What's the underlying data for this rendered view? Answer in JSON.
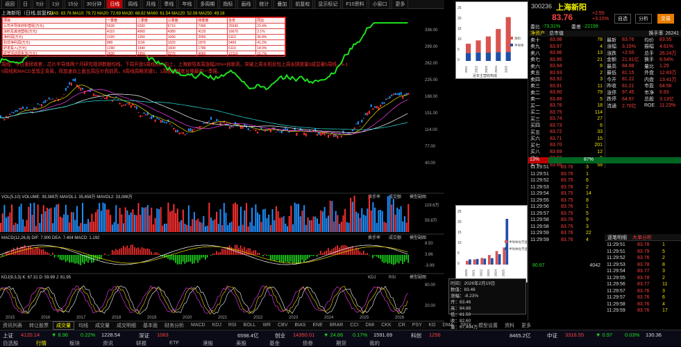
{
  "toolbar": {
    "items": [
      "返回",
      "日",
      "5分",
      "1分",
      "15分",
      "30分钟",
      "日线",
      "周线",
      "月线",
      "季线",
      "年线",
      "多周期",
      "指标",
      "画线",
      "统计",
      "叠加",
      "前复权",
      "显示标记",
      "F10资料",
      "小窗口",
      "更多"
    ],
    "active_index": 6
  },
  "chart": {
    "title": "上海新阳（日线,前复权）",
    "ma_line": "MA5: 83.76  MA10: 79.72  MA20: 72.69  MA30: 68.62  MA60: 61.54  MA120: 52.08  MA250: 49.18",
    "right_tabs": [
      "公告",
      "叠加",
      "指标",
      "回顾"
    ],
    "comment": "周线：今日重磅收官，芯片半导体两个月研究观测数据均线，下周开盘5周线拐头向上，上海新阳本周涨幅20%+创新高，突破上周长阳反包上周长阴放量3成显著5周线，5-10周线和MACD呈现正背离，拜加速向上面五周压价而前高，9周线周期关键1，1周面超越底长期最的一季报。",
    "price_labels": [
      "336.00",
      "299.00",
      "262.00",
      "225.00",
      "188.00",
      "151.00",
      "114.00",
      "77.00",
      "40.00"
    ],
    "vol_title": "VOL(5,10)  VOLUME: 39,369万  MAVOL1: 35,658万  MAVOL2: 33,086万",
    "vol_tabs": [
      "换手率",
      "成交额",
      "模型副图"
    ],
    "vol_labels": [
      "119.6万",
      "59.8万"
    ],
    "macd_title": "MACD(12,26,9)  DIF: 7.900  DEA: 7.404  MACD: 1.192",
    "macd_tabs": [
      "换手率",
      "成交额",
      "模型副图"
    ],
    "macd_labels": [
      "8.50",
      "3.86",
      "-3.99"
    ],
    "kdj_title": "KDJ(9,3,3)  K: 67.31  D: 59.99  J: 81.95",
    "kdj_tabs": [
      "KDJ",
      "RSI",
      "模型副图"
    ],
    "kdj_labels": [
      "80.00",
      "20.00"
    ],
    "years": [
      "2015",
      "2016",
      "2017",
      "2018",
      "2019",
      "2020",
      "2021",
      "2022",
      "2023",
      "2024",
      "2025",
      "2026"
    ],
    "volume_profile_label": "成本分布"
  },
  "datatable": {
    "headers": [
      "项目",
      "一季度",
      "二季度",
      "三季度",
      "四季度",
      "全年",
      "同比"
    ],
    "rows": [
      [
        "公司半导体材料营收(万元)",
        "5630",
        "6200",
        "6710",
        "7390",
        "25930",
        "23.4%"
      ],
      [
        "涂料及其他营收(万元)",
        "4110",
        "4060",
        "4380",
        "4120",
        "16670",
        "2.1%"
      ],
      [
        "净利润(万元)",
        "1020",
        "1350",
        "1690",
        "2050",
        "6110",
        "36.8%"
      ],
      [
        "扣非净利润(万元)",
        "880",
        "1190",
        "1520",
        "1870",
        "5460",
        "41.2%"
      ],
      [
        "研发投入(万元)",
        "1290",
        "1440",
        "1600",
        "1780",
        "6110",
        "18.9%"
      ],
      [
        "经营活动现金流(万元)",
        "2830",
        "1950",
        "3270",
        "4060",
        "12110",
        "15.7%"
      ]
    ]
  },
  "popup1": {
    "legend": [
      "涂料",
      "半导体"
    ],
    "caption": "近年主营收构成",
    "years": [
      "2021",
      "2022",
      "2023",
      "2024",
      "2025"
    ],
    "coat": [
      3.8,
      4.1,
      4.0,
      4.2,
      4.3
    ],
    "semi": [
      4.5,
      5.8,
      7.8,
      11.2,
      16.8
    ],
    "ylim": [
      0,
      25
    ],
    "ticks": [
      "25",
      "20",
      "15",
      "10",
      "5",
      "0"
    ]
  },
  "popup2": {
    "legend": [
      "半导体化学品营收（亿元）",
      "半导体化学品产能（万吨）"
    ],
    "years": [
      "2020",
      "2021",
      "2022",
      "2023",
      "2024",
      "2025"
    ],
    "rev": [
      1.8,
      2.5,
      3.2,
      4.6,
      6.5,
      8.2
    ],
    "cap": [
      2.5,
      2.7,
      2.9,
      3.1,
      5.0,
      22.0
    ],
    "ylim": [
      0,
      25
    ],
    "ticks": [
      "25",
      "20",
      "15",
      "10",
      "5",
      "0"
    ]
  },
  "tooltip": {
    "lines": [
      "时间：2026年2月19日",
      "数值：83.46",
      "涨幅：-8.23%",
      "开：83.46",
      "高：84.88",
      "低：81.50",
      "收：82.60",
      "量：67,494万"
    ]
  },
  "bottomtabs": [
    "资讯列表",
    "转让股票",
    "成交量",
    "均线",
    "成交量",
    "成交明细",
    "基本面",
    "财务分析",
    "MACD",
    "KDJ",
    "RSI",
    "BOLL",
    "WR",
    "CBV",
    "BIAS",
    "ENE",
    "BRAR",
    "CCI",
    "DMI",
    "CKK",
    "CR",
    "PSY",
    "KD",
    "DMA",
    "TRIX",
    "模型设置",
    "资料",
    "更多"
  ],
  "rightpanel": {
    "code": "300236",
    "name": "上海新阳",
    "price": "83.76",
    "change": "+2.55",
    "pct": "+3.15%",
    "btn1": "自选",
    "btn2": "交易",
    "btn3": "分析",
    "ratio_label": "委比",
    "ratio_value": "-73.31%",
    "diff_label": "委差",
    "diff_value": "-22199",
    "tabs": [
      "净资产",
      "总市值"
    ],
    "summary_label": "换手率",
    "summary_value": "26241",
    "asks": [
      [
        "卖十",
        "83.98",
        "78"
      ],
      [
        "卖九",
        "83.97",
        "4"
      ],
      [
        "卖八",
        "83.96",
        "13"
      ],
      [
        "卖七",
        "83.95",
        "21"
      ],
      [
        "卖六",
        "83.94",
        "8"
      ],
      [
        "卖五",
        "83.93",
        "2"
      ],
      [
        "卖四",
        "83.92",
        "3"
      ],
      [
        "卖三",
        "83.91",
        "11"
      ],
      [
        "卖二",
        "83.90",
        "79"
      ],
      [
        "卖一",
        "83.89",
        "5"
      ]
    ],
    "bids": [
      [
        "买一",
        "83.76",
        "18"
      ],
      [
        "买二",
        "83.75",
        "114"
      ],
      [
        "买三",
        "83.74",
        "27"
      ],
      [
        "买四",
        "83.73",
        "6"
      ],
      [
        "买五",
        "83.72",
        "33"
      ],
      [
        "买六",
        "83.71",
        "15"
      ],
      [
        "买七",
        "83.70",
        "201"
      ],
      [
        "买八",
        "83.69",
        "12"
      ],
      [
        "买九",
        "83.68",
        "9"
      ],
      [
        "买十",
        "83.66",
        "58"
      ]
    ],
    "stats": [
      [
        "最新",
        "83.76",
        "均价",
        "83.55"
      ],
      [
        "涨幅",
        "3.15%",
        "振幅",
        "4.61%"
      ],
      [
        "涨跌",
        "+2.55",
        "总手",
        "26.24万"
      ],
      [
        "金额",
        "21.91亿",
        "换手",
        "8.54%"
      ],
      [
        "最高",
        "84.88",
        "量比",
        "1.29"
      ],
      [
        "最低",
        "81.15",
        "外盘",
        "12.83万"
      ],
      [
        "今开",
        "81.22",
        "内盘",
        "13.41万"
      ],
      [
        "昨收",
        "81.21",
        "市盈",
        "64.56"
      ],
      [
        "涨停",
        "97.45",
        "市净",
        "6.83"
      ],
      [
        "跌停",
        "64.97",
        "总股",
        "3.13亿"
      ],
      [
        "流通",
        "2.70亿",
        "ROE",
        "11.23%"
      ]
    ],
    "bar_pct": "87%",
    "bar_left": "13%",
    "ticks": [
      [
        "11:29:51",
        "83.76",
        "3"
      ],
      [
        "11:29:51",
        "83.76",
        "1"
      ],
      [
        "11:29:52",
        "83.75",
        "6"
      ],
      [
        "11:29:53",
        "83.76",
        "2"
      ],
      [
        "11:29:54",
        "83.75",
        "14"
      ],
      [
        "11:29:55",
        "83.75",
        "8"
      ],
      [
        "11:29:56",
        "83.76",
        "1"
      ],
      [
        "11:29:57",
        "83.75",
        "5"
      ],
      [
        "11:29:58",
        "83.76",
        "9"
      ],
      [
        "11:29:58",
        "83.75",
        "3"
      ],
      [
        "11:29:59",
        "83.76",
        "22"
      ],
      [
        "11:29:59",
        "83.76",
        "4"
      ]
    ],
    "lower_tabs": [
      "逐笔明细",
      "大单分析"
    ],
    "lower_ticks": [
      [
        "11:29:51",
        "83.78",
        "1"
      ],
      [
        "11:29:51",
        "83.79",
        "5"
      ],
      [
        "11:29:52",
        "83.76",
        "2"
      ],
      [
        "11:29:53",
        "83.78",
        "8"
      ],
      [
        "11:29:54",
        "83.77",
        "3"
      ],
      [
        "11:29:55",
        "83.78",
        "2"
      ],
      [
        "11:29:56",
        "83.77",
        "11"
      ],
      [
        "11:29:57",
        "83.76",
        "3"
      ],
      [
        "11:29:57",
        "83.76",
        "6"
      ],
      [
        "11:29:58",
        "83.76",
        "4"
      ],
      [
        "11:29:59",
        "83.76",
        "17"
      ]
    ],
    "sell_vol": "80.67",
    "buy_vol": "4042"
  },
  "statusbar": {
    "items": [
      {
        "name": "上证",
        "val": "4120.14",
        "chg": "▼ 8.96",
        "pct": "0.22%",
        "amt": "1228.54"
      },
      {
        "name": "深证",
        "val": "1063",
        "chg": "",
        "pct": "",
        "amt": "6598.4亿"
      },
      {
        "name": "创业",
        "val": "14350.01",
        "chg": "▼ 24.86",
        "pct": "0.17%",
        "amt": "1591.69"
      },
      {
        "name": "科创",
        "val": "1256",
        "chg": "",
        "pct": "",
        "amt": "8465.2亿"
      },
      {
        "name": "中证",
        "val": "3316.55",
        "chg": "▼ 0.97",
        "pct": "0.03%",
        "amt": "130.36"
      }
    ],
    "tabs": [
      "自选股",
      "行情",
      "板块",
      "资讯",
      "研报",
      "ETF",
      "港股",
      "美股",
      "基金",
      "债券",
      "期货",
      "我的"
    ],
    "selected": 1
  }
}
